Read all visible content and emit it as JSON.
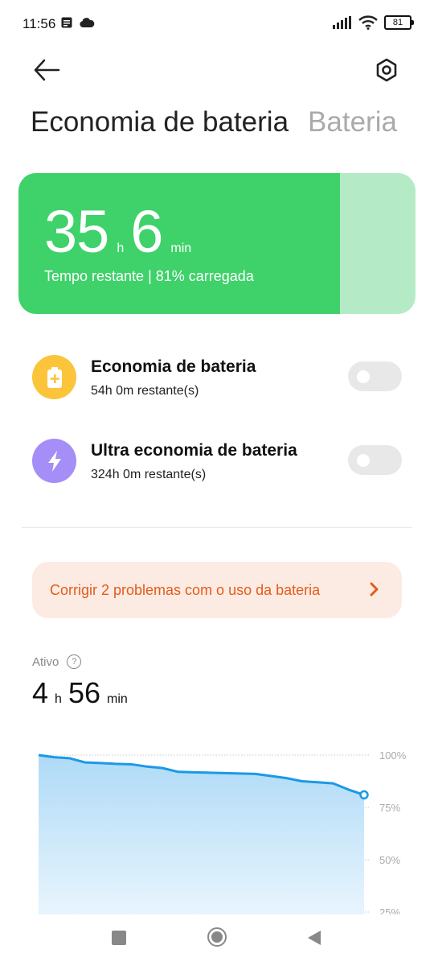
{
  "status": {
    "time": "11:56",
    "battery_level": "81",
    "icons": [
      "notification-icon",
      "cloud-icon",
      "signal-icon",
      "wifi-icon",
      "battery-icon"
    ]
  },
  "header": {
    "title": "Economia de bateria",
    "alt_tab": "Bateria"
  },
  "battery_card": {
    "hours": "35",
    "hours_unit": "h",
    "minutes": "6",
    "minutes_unit": "min",
    "subtitle": "Tempo restante | 81% carregada",
    "charge_fraction": 0.81,
    "fill_color": "#3fd26a",
    "remaining_color": "#b4ebc6"
  },
  "modes": [
    {
      "title": "Economia de bateria",
      "subtitle": "54h 0m restante(s)",
      "icon": "battery-plus-icon",
      "icon_color": "#fbc43b",
      "enabled": false
    },
    {
      "title": "Ultra economia de bateria",
      "subtitle": "324h 0m restante(s)",
      "icon": "lightning-icon",
      "icon_color": "#a58ef7",
      "enabled": false
    }
  ],
  "fix_banner": {
    "text": "Corrigir 2 problemas com o uso da bateria",
    "color": "#e35b1a"
  },
  "active": {
    "label": "Ativo",
    "hours": "4",
    "hours_unit": "h",
    "minutes": "56",
    "minutes_unit": "min"
  },
  "chart_data": {
    "type": "area",
    "y_tick_labels": [
      "100%",
      "75%",
      "50%",
      "25%"
    ],
    "y_ticks": [
      100,
      75,
      50,
      25
    ],
    "ylim": [
      25,
      100
    ],
    "x": [
      0,
      1,
      2,
      3,
      4,
      5,
      6,
      7,
      8,
      9,
      10,
      11,
      12,
      13,
      14,
      15,
      16,
      17,
      18,
      19,
      20,
      21
    ],
    "values": [
      100,
      99,
      98.5,
      96.5,
      96.2,
      95.8,
      95.6,
      94.5,
      93.8,
      92,
      91.8,
      91.6,
      91.4,
      91.2,
      91,
      90,
      89,
      87.5,
      87,
      86.5,
      83.5,
      81
    ],
    "line_color": "#1a9ae6",
    "grid": true
  }
}
